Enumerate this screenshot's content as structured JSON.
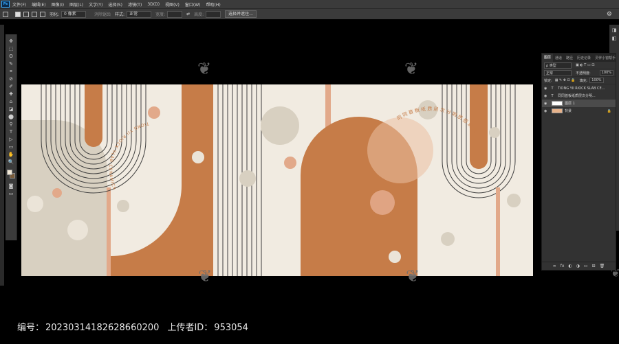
{
  "menubar": {
    "logo": "Ps",
    "items": [
      "文件(F)",
      "编辑(E)",
      "图像(I)",
      "图层(L)",
      "文字(Y)",
      "选择(S)",
      "滤镜(T)",
      "3D(D)",
      "视图(V)",
      "窗口(W)",
      "帮助(H)"
    ]
  },
  "options": {
    "feather_label": "羽化:",
    "feather_value": "0 像素",
    "antialias_label": "消除锯齿",
    "style_label": "样式:",
    "style_value": "正常",
    "width_label": "宽度:",
    "height_label": "高度:",
    "select_mask_button": "选择并遮住..."
  },
  "tools": [
    "✥",
    "⬚",
    "ʘ",
    "✎",
    "⌗",
    "⊘",
    "✐",
    "✚",
    "⌂",
    "◪",
    "⬤",
    "⚲",
    "T",
    "▷",
    "▭",
    "✋",
    "🔍"
  ],
  "layers_panel": {
    "tabs": [
      "图层",
      "通道",
      "路径",
      "历史记录",
      "灵伴小窗帮手"
    ],
    "filter_label": "ρ 类型",
    "blend_mode": "正常",
    "opacity_label": "不透明度:",
    "opacity_value": "100%",
    "lock_label": "锁定:",
    "fill_label": "填充:",
    "fill_value": "100%",
    "layers": [
      {
        "type": "T",
        "name": "TIONG YII RIOCK SLAB CE..."
      },
      {
        "type": "T",
        "name": "同同首板纸质层次分明..."
      },
      {
        "type": "img",
        "name": "图层 1"
      },
      {
        "type": "bg",
        "name": "背景"
      }
    ],
    "footer_icons": [
      "∞",
      "fx",
      "◐",
      "◑",
      "▭",
      "⊞",
      "🗑"
    ]
  },
  "artwork": {
    "colors": {
      "bg": "#f1ebe1",
      "terracotta": "#c67c48",
      "beige": "#d8d0c1",
      "peach": "#e2a98a",
      "line": "#3e3e3e"
    },
    "curved_text_left": "TIONG YII RIOCK SLAB CERAMICS",
    "curved_text_right": "同同首板纸质层次分明质感满满"
  },
  "footer": {
    "id_label": "编号：",
    "id_value": "20230314182628660200",
    "uploader_label": "上传者ID：",
    "uploader_value": "953054"
  }
}
